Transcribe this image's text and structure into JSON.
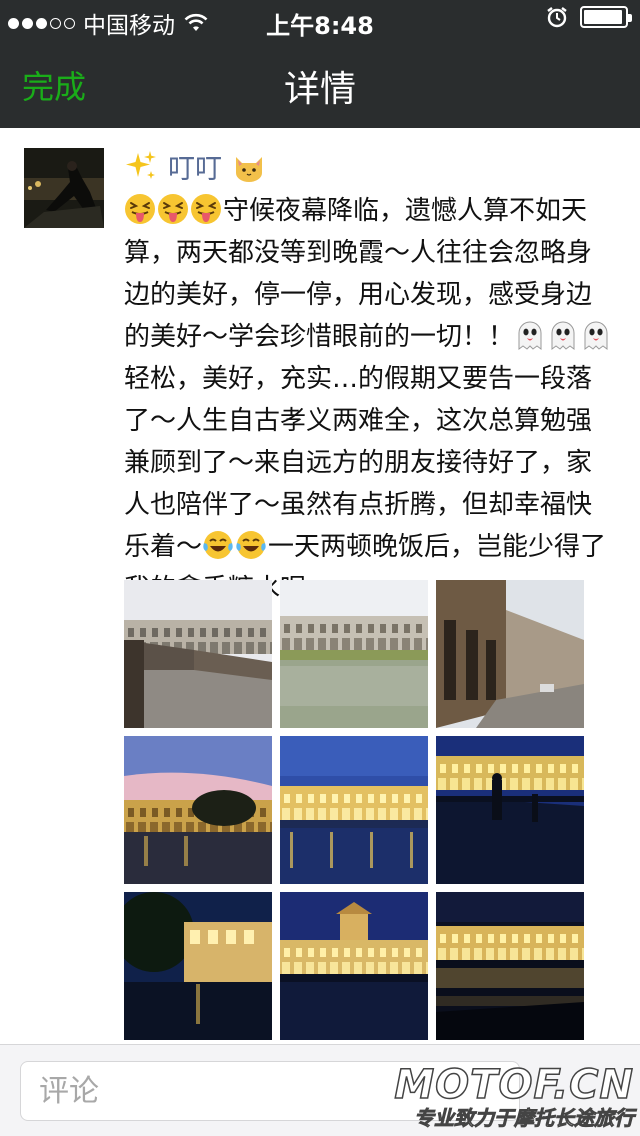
{
  "status_bar": {
    "carrier": "中国移动",
    "time": "上午8:48",
    "signal_bars_filled": 3,
    "signal_bars_total": 5
  },
  "nav": {
    "done_label": "完成",
    "title": "详情"
  },
  "post": {
    "username": "叮叮",
    "avatar_icon": "avatar-photo",
    "text_segments": [
      {
        "type": "emoji",
        "name": "squinting-tongue-emoji"
      },
      {
        "type": "emoji",
        "name": "squinting-tongue-emoji"
      },
      {
        "type": "emoji",
        "name": "squinting-tongue-emoji"
      },
      {
        "type": "text",
        "value": "守候夜幕降临，遗憾人算不如天算，两天都没等到晚霞～人往往会忽略身边的美好，停一停，用心发现，感受身边的美好～学会珍惜眼前的一切！！"
      },
      {
        "type": "emoji",
        "name": "ghost-emoji"
      },
      {
        "type": "emoji",
        "name": "ghost-emoji"
      },
      {
        "type": "emoji",
        "name": "ghost-emoji"
      },
      {
        "type": "text",
        "value": "轻松，美好，充实…的假期又要告一段落了～人生自古孝义两难全，这次总算勉强兼顾到了～来自远方的朋友接待好了，家人也陪伴了～虽然有点折腾，但却幸福快乐着～"
      },
      {
        "type": "emoji",
        "name": "tears-of-joy-emoji"
      },
      {
        "type": "emoji",
        "name": "tears-of-joy-emoji"
      },
      {
        "type": "text",
        "value": "一天两顿晚饭后，岂能少得了我的拿手糖水呢～"
      }
    ],
    "photos": [
      {
        "name": "photo-riverside-bridge-day"
      },
      {
        "name": "photo-river-arcade-day"
      },
      {
        "name": "photo-arcade-street-day"
      },
      {
        "name": "photo-dusk-river"
      },
      {
        "name": "photo-lit-arcade-river"
      },
      {
        "name": "photo-night-bridge-figure"
      },
      {
        "name": "photo-night-trees-building"
      },
      {
        "name": "photo-night-tower-building"
      },
      {
        "name": "photo-night-reflection"
      }
    ]
  },
  "comment": {
    "placeholder": "评论"
  },
  "watermark": {
    "logo": "MOTOF.CN",
    "slogan": "专业致力于摩托长途旅行"
  },
  "colors": {
    "nav_bg": "#2a2d2e",
    "accent_green": "#1aad19",
    "username_blue": "#576b95"
  }
}
